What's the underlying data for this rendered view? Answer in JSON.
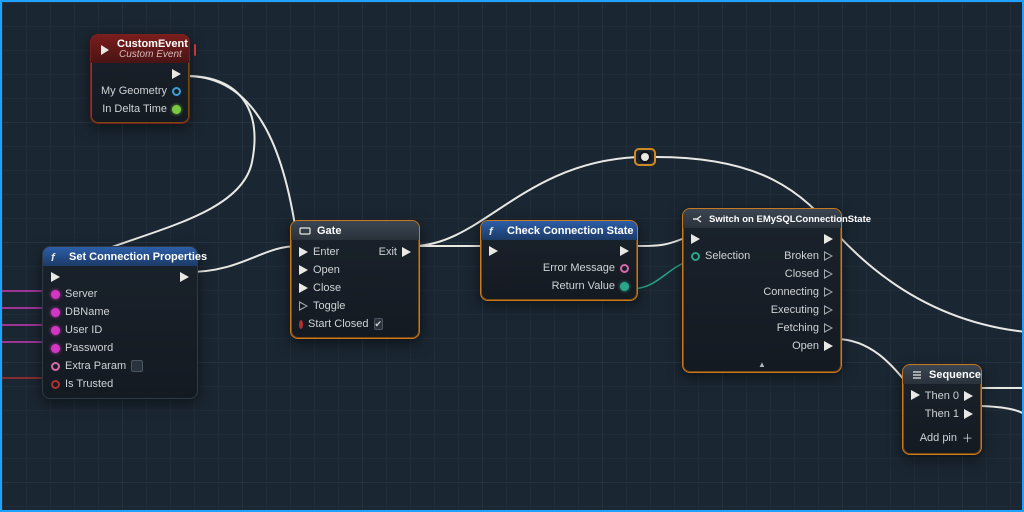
{
  "nodes": {
    "customEvent": {
      "title": "CustomEvent",
      "subtitle": "Custom Event",
      "pins_out": [
        "",
        "My Geometry",
        "In Delta Time"
      ]
    },
    "setConn": {
      "title": "Set Connection Properties",
      "pins_in": [
        "",
        "Server",
        "DBName",
        "User ID",
        "Password",
        "Extra Param",
        "Is Trusted"
      ]
    },
    "gate": {
      "title": "Gate",
      "pins_in": [
        "Enter",
        "Open",
        "Close",
        "Toggle",
        "Start Closed"
      ],
      "pins_out": [
        "Exit"
      ]
    },
    "checkConn": {
      "title": "Check Connection State",
      "pins_out_labels": [
        "",
        "Error Message",
        "Return Value"
      ]
    },
    "switch": {
      "title": "Switch on EMySQLConnectionState",
      "pin_in_label": "Selection",
      "pins_out": [
        "",
        "Broken",
        "Closed",
        "Connecting",
        "Executing",
        "Fetching",
        "Open"
      ]
    },
    "sequence": {
      "title": "Sequence",
      "pins_out": [
        "Then 0",
        "Then 1"
      ],
      "footer": "Add pin"
    }
  }
}
